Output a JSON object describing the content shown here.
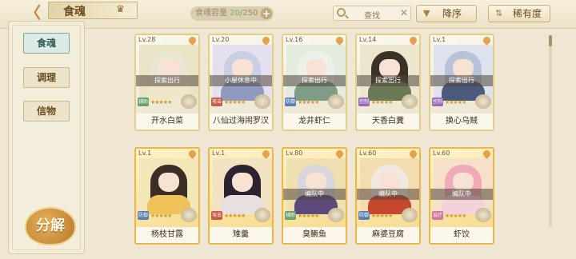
{
  "header": {
    "title": "食魂",
    "capacity_label": "食魂容量",
    "capacity_current": "20",
    "capacity_max": "/250",
    "search_placeholder": "查找",
    "sort_label": "降序",
    "filter_label": "稀有度"
  },
  "sidebar": {
    "tabs": [
      {
        "label": "食魂",
        "active": true
      },
      {
        "label": "调理",
        "active": false
      },
      {
        "label": "信物",
        "active": false
      }
    ],
    "decompose_label": "分解"
  },
  "cards": [
    {
      "level": "Lv.28",
      "status": "探索出行",
      "tag": "辅助",
      "tag_color": "#6aa36a",
      "stars": 5,
      "name": "开水白菜",
      "hair": "#e9e7d4",
      "body": "#efe7c8",
      "bg": "#eae4c6",
      "gold": false
    },
    {
      "level": "Lv.20",
      "status": "小屋休息中",
      "tag": "攻击",
      "tag_color": "#c85a4a",
      "stars": 5,
      "name": "八仙过海闹罗汉",
      "hair": "#c9d0e6",
      "body": "#8e9bbf",
      "bg": "#e5e0ef",
      "gold": false
    },
    {
      "level": "Lv.16",
      "status": "探索出行",
      "tag": "防御",
      "tag_color": "#5a7fb5",
      "stars": 5,
      "name": "龙井虾仁",
      "hair": "#eef0ea",
      "body": "#7f9c86",
      "bg": "#e3ecdf",
      "gold": false
    },
    {
      "level": "Lv.14",
      "status": "探索出行",
      "tag": "控制",
      "tag_color": "#9a6ab5",
      "stars": 5,
      "name": "天香白糞",
      "hair": "#3a3226",
      "body": "#6b7a56",
      "bg": "#ece6cf",
      "gold": false
    },
    {
      "level": "Lv.1",
      "status": "探索出行",
      "tag": "控制",
      "tag_color": "#9a6ab5",
      "stars": 5,
      "name": "换心乌贼",
      "hair": "#b8c3d9",
      "body": "#4a5a7a",
      "bg": "#dde2ec",
      "gold": false
    },
    {
      "level": "Lv.1",
      "status": "",
      "tag": "防御",
      "tag_color": "#5a7fb5",
      "stars": 5,
      "name": "杨枝甘露",
      "hair": "#3b2e27",
      "body": "#f0c25a",
      "bg": "#f3e6b8",
      "gold": true
    },
    {
      "level": "Lv.1",
      "status": "",
      "tag": "攻击",
      "tag_color": "#c85a4a",
      "stars": 5,
      "name": "雉羹",
      "hair": "#2b2330",
      "body": "#e8e0e0",
      "bg": "#f2e2c2",
      "gold": true
    },
    {
      "level": "Lv.80",
      "status": "编队中",
      "tag": "辅助",
      "tag_color": "#6aa36a",
      "stars": 5,
      "name": "臭鳜鱼",
      "hair": "#d8d6dd",
      "body": "#5b4a7a",
      "bg": "#f0dfb0",
      "gold": true
    },
    {
      "level": "Lv.60",
      "status": "编队中",
      "tag": "防御",
      "tag_color": "#5a7fb5",
      "stars": 5,
      "name": "麻婆豆腐",
      "hair": "#efe9e0",
      "body": "#c7462e",
      "bg": "#f3dcb0",
      "gold": true
    },
    {
      "level": "Lv.60",
      "status": "编队中",
      "tag": "治疗",
      "tag_color": "#d07aa0",
      "stars": 5,
      "name": "虾饺",
      "hair": "#f2a9b8",
      "body": "#f4d2da",
      "bg": "#f6e1c8",
      "gold": true
    }
  ]
}
